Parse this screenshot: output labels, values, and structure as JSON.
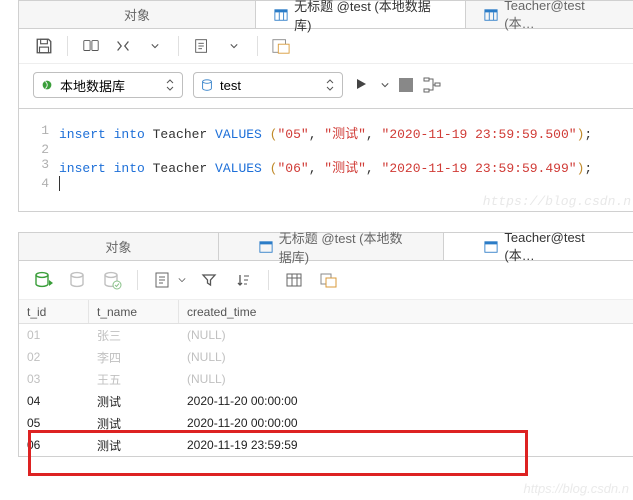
{
  "top": {
    "tabs": [
      {
        "label": "对象"
      },
      {
        "label": "无标题 @test (本地数据库)"
      },
      {
        "label": "Teacher@test (本…"
      }
    ],
    "connectionCombo": "本地数据库",
    "dbCombo": "test"
  },
  "editor": {
    "lines": [
      {
        "n": "1",
        "parts": [
          "insert into ",
          "Teacher ",
          "VALUES ",
          "(",
          "\"05\"",
          ", ",
          "\"测试\"",
          ", ",
          "\"2020-11-19 23:59:59.500\"",
          ")",
          ";"
        ]
      },
      {
        "n": "2",
        "parts": [
          ""
        ]
      },
      {
        "n": "3",
        "parts": [
          "insert into ",
          "Teacher ",
          "VALUES ",
          "(",
          "\"06\"",
          ", ",
          "\"测试\"",
          ", ",
          "\"2020-11-19 23:59:59.499\"",
          ")",
          ";"
        ]
      },
      {
        "n": "4",
        "parts": [
          ""
        ]
      }
    ]
  },
  "watermark": "https://blog.csdn.n",
  "bottom": {
    "tabs": [
      {
        "label": "对象"
      },
      {
        "label": "无标题 @test (本地数据库)"
      },
      {
        "label": "Teacher@test (本…"
      }
    ],
    "columns": {
      "c1": "t_id",
      "c2": "t_name",
      "c3": "created_time"
    },
    "rows": [
      {
        "id": "01",
        "name": "张三",
        "time": "(NULL)",
        "dim": true
      },
      {
        "id": "02",
        "name": "李四",
        "time": "(NULL)",
        "dim": true
      },
      {
        "id": "03",
        "name": "王五",
        "time": "(NULL)",
        "dim": true
      },
      {
        "id": "04",
        "name": "测试",
        "time": "2020-11-20 00:00:00",
        "dim": false
      },
      {
        "id": "05",
        "name": "测试",
        "time": "2020-11-20 00:00:00",
        "dim": false
      },
      {
        "id": "06",
        "name": "测试",
        "time": "2020-11-19 23:59:59",
        "dim": false
      }
    ]
  }
}
